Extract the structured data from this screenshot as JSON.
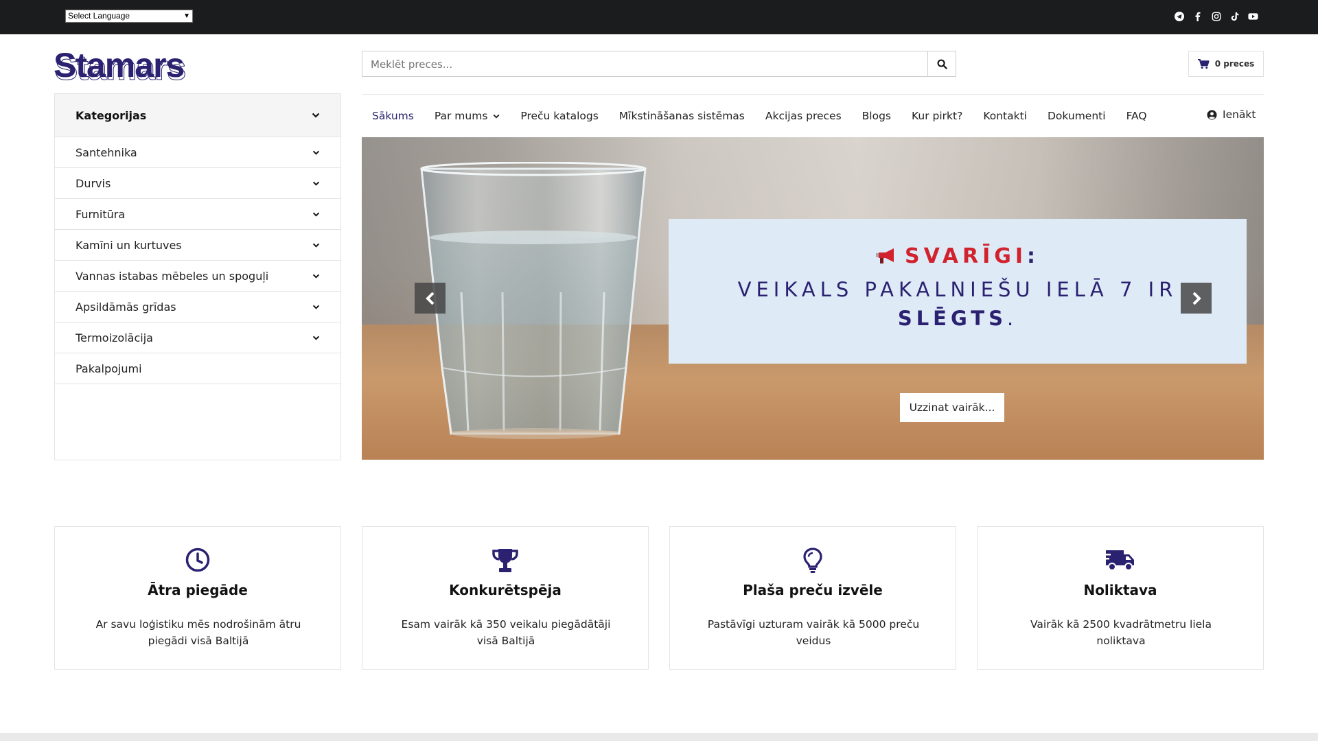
{
  "topbar": {
    "language_select": "Select Language",
    "socials": [
      "telegram-icon",
      "facebook-icon",
      "instagram-icon",
      "tiktok-icon",
      "youtube-icon"
    ]
  },
  "header": {
    "logo": "Stamars",
    "search_placeholder": "Meklēt preces...",
    "cart_label": "0 preces"
  },
  "sidebar": {
    "title": "Kategorijas",
    "items": [
      {
        "label": "Santehnika",
        "has_children": true
      },
      {
        "label": "Durvis",
        "has_children": true
      },
      {
        "label": "Furnitūra",
        "has_children": true
      },
      {
        "label": "Kamīni un kurtuves",
        "has_children": true
      },
      {
        "label": "Vannas istabas mēbeles un spoguļi",
        "has_children": true
      },
      {
        "label": "Apsildāmās grīdas",
        "has_children": true
      },
      {
        "label": "Termoizolācija",
        "has_children": true
      },
      {
        "label": "Pakalpojumi",
        "has_children": false
      }
    ]
  },
  "nav": {
    "items": [
      {
        "label": "Sākums",
        "active": true
      },
      {
        "label": "Par mums",
        "dropdown": true
      },
      {
        "label": "Preču katalogs"
      },
      {
        "label": "Mīkstināšanas sistēmas"
      },
      {
        "label": "Akcijas preces"
      },
      {
        "label": "Blogs"
      },
      {
        "label": "Kur pirkt?"
      },
      {
        "label": "Kontakti"
      },
      {
        "label": "Dokumenti"
      },
      {
        "label": "FAQ"
      }
    ],
    "login": "Ienākt"
  },
  "hero": {
    "headline_word": "SVARĪGI",
    "headline_colon": ":",
    "line2": "VEIKALS PAKALNIEŠU IELĀ 7 IR",
    "line3": "SLĒGTS",
    "line3_end": ".",
    "button": "Uzzinat vairāk..."
  },
  "features": [
    {
      "icon": "clock-icon",
      "title": "Ātra piegāde",
      "text": "Ar savu loģistiku mēs nodrošinām ātru piegādi visā Baltijā"
    },
    {
      "icon": "trophy-icon",
      "title": "Konkurētspēja",
      "text": "Esam vairāk kā 350 veikalu piegādātāji visā Baltijā"
    },
    {
      "icon": "lightbulb-icon",
      "title": "Plaša preču izvēle",
      "text": "Pastāvīgi uzturam vairāk kā 5000 preču veidus"
    },
    {
      "icon": "truck-icon",
      "title": "Noliktava",
      "text": "Vairāk kā 2500 kvadrātmetru liela noliktava"
    }
  ],
  "colors": {
    "brand": "#2a2270",
    "alert": "#d1232e",
    "topbar": "#1b1c1e",
    "notice_bg": "#dfeaf7"
  }
}
